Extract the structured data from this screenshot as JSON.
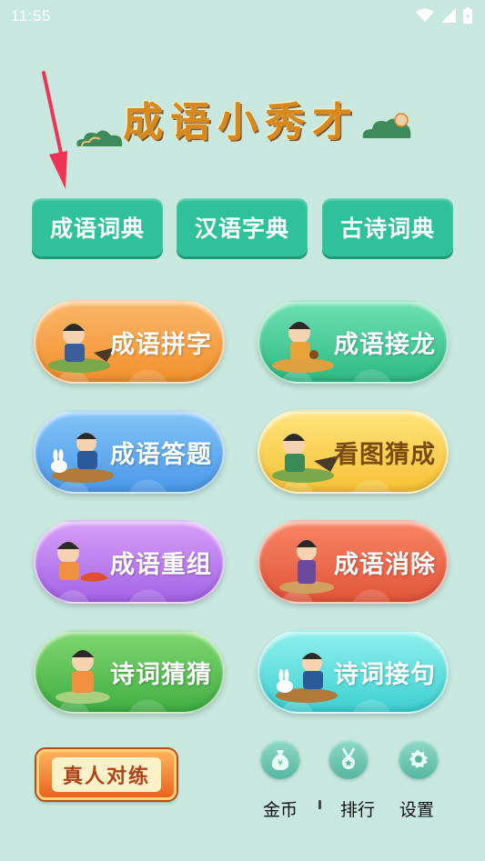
{
  "status_bar": {
    "time": "11:55"
  },
  "title": "成语小秀才",
  "top_buttons": [
    {
      "label": "成语词典"
    },
    {
      "label": "汉语字典"
    },
    {
      "label": "古诗词典"
    }
  ],
  "games": [
    {
      "label": "成语拼字",
      "color": "orange"
    },
    {
      "label": "成语接龙",
      "color": "green"
    },
    {
      "label": "成语答题",
      "color": "blue"
    },
    {
      "label": "看图猜成",
      "color": "yellow"
    },
    {
      "label": "成语重组",
      "color": "purple"
    },
    {
      "label": "成语消除",
      "color": "red"
    },
    {
      "label": "诗词猜猜",
      "color": "dark-green"
    },
    {
      "label": "诗词接句",
      "color": "cyan"
    }
  ],
  "real_battle": {
    "label": "真人对练"
  },
  "bottom_nav": [
    {
      "label": "金币",
      "icon": "coin-bag-icon"
    },
    {
      "label": "排行",
      "icon": "medal-icon"
    },
    {
      "label": "设置",
      "icon": "gear-icon"
    }
  ],
  "colors": {
    "background": "#c8e8df",
    "accent_green": "#2fc29a",
    "title_gold": "#d8891a",
    "arrow_red": "#ee3355"
  }
}
